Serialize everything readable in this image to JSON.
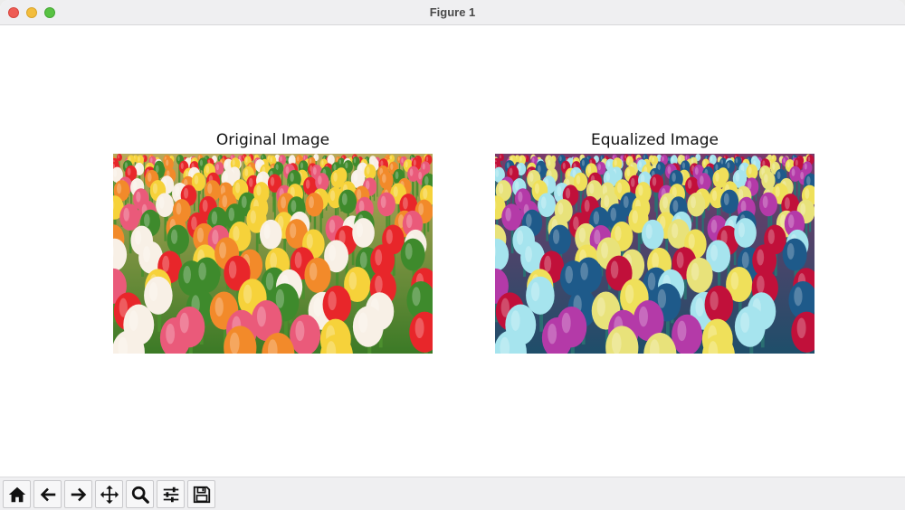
{
  "window": {
    "title": "Figure 1"
  },
  "figure": {
    "left_axes": {
      "title": "Original Image"
    },
    "right_axes": {
      "title": "Equalized Image"
    }
  },
  "toolbar": {
    "buttons": [
      {
        "name": "home",
        "icon": "home-icon"
      },
      {
        "name": "back",
        "icon": "arrow-left-icon"
      },
      {
        "name": "forward",
        "icon": "arrow-right-icon"
      },
      {
        "name": "pan",
        "icon": "move-icon"
      },
      {
        "name": "zoom",
        "icon": "magnifier-icon"
      },
      {
        "name": "configure-subplots",
        "icon": "sliders-icon"
      },
      {
        "name": "save",
        "icon": "floppy-icon"
      }
    ]
  },
  "colors": {
    "original_palette": [
      "#e8262a",
      "#f6d23a",
      "#f8f0e6",
      "#ea5a7a",
      "#3e8a2c",
      "#f28a2a"
    ],
    "equalized_palette": [
      "#c1103a",
      "#efe05a",
      "#a6e4ee",
      "#b43aa8",
      "#1e5a8a",
      "#e8e27a"
    ]
  }
}
